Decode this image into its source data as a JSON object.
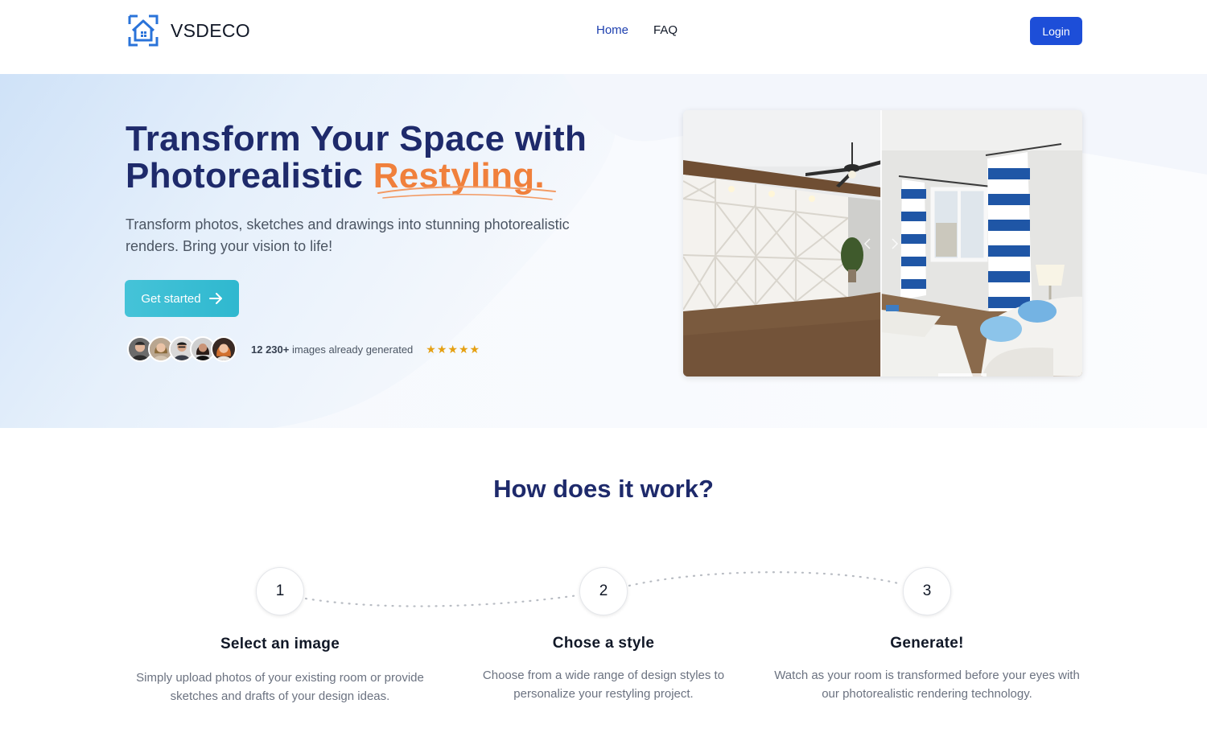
{
  "nav": {
    "brand": "VSDECO",
    "links": [
      "Home",
      "FAQ"
    ],
    "login": "Login"
  },
  "hero": {
    "title_line1": "Transform Your Space with",
    "title_line2_plain": "Photorealistic ",
    "title_line2_accent": "Restyling.",
    "subtitle": "Transform photos, sketches and drawings into stunning photorealistic renders. Bring your vision to life!",
    "cta": "Get started",
    "social_count": "12 230+",
    "social_text": " images already generated",
    "stars": "★★★★★"
  },
  "how": {
    "title": "How does it work?",
    "steps": [
      {
        "number": "1",
        "title": "Select an image",
        "desc": "Simply upload photos of your existing room or provide sketches and drafts of your design ideas."
      },
      {
        "number": "2",
        "title": "Chose a style",
        "desc": "Choose from a wide range of design styles to personalize your restyling project."
      },
      {
        "number": "3",
        "title": "Generate!",
        "desc": "Watch as your room is transformed before your eyes with our photorealistic rendering technology."
      }
    ]
  },
  "colors": {
    "primary": "#1d4ed8",
    "heading": "#1e2a6b",
    "accent": "#f0803c",
    "cta": "#3dbfd5",
    "star": "#e5a012"
  }
}
